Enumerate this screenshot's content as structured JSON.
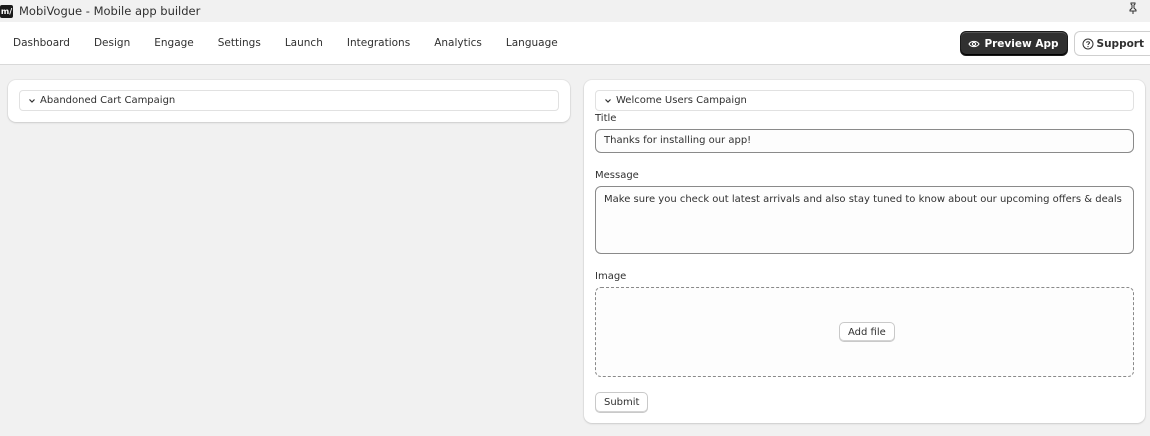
{
  "window": {
    "logo_text": "m/",
    "title": "MobiVogue - Mobile app builder"
  },
  "nav": {
    "items": [
      {
        "label": "Dashboard"
      },
      {
        "label": "Design"
      },
      {
        "label": "Engage"
      },
      {
        "label": "Settings"
      },
      {
        "label": "Launch"
      },
      {
        "label": "Integrations"
      },
      {
        "label": "Analytics"
      },
      {
        "label": "Language"
      }
    ],
    "preview_label": "Preview App",
    "support_label": "Support"
  },
  "left_panel": {
    "campaign_label": "Abandoned Cart Campaign"
  },
  "right_panel": {
    "campaign_label": "Welcome Users Campaign",
    "title_label": "Title",
    "title_value": "Thanks for installing our app!",
    "message_label": "Message",
    "message_value": "Make sure you check out latest arrivals and also stay tuned to know about our upcoming offers & deals",
    "image_label": "Image",
    "add_file_label": "Add file",
    "submit_label": "Submit"
  },
  "colors": {
    "background": "#f1f1f1",
    "primary_button": "#303030",
    "card": "#ffffff"
  },
  "icons": [
    "app-logo-icon",
    "pin-icon",
    "eye-icon",
    "help-circle-icon",
    "chevron-down-icon"
  ]
}
